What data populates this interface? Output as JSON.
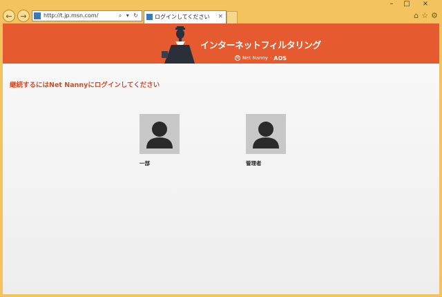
{
  "browser": {
    "address_url": "http://t.jp.msn.com/",
    "address_tools": "⌕ ▾ ↻",
    "tab_title": "ログインしてください",
    "tab_close": "×",
    "back_icon": "←",
    "forward_icon": "→",
    "window_controls": {
      "minimize": "–",
      "maximize": "□",
      "close": "×"
    },
    "right_icons": {
      "home": "⌂",
      "favorites": "☆",
      "settings": "⚙"
    }
  },
  "banner": {
    "title": "インターネットフィルタリング",
    "brand_mark": "N",
    "brand_name": "Net Nanny",
    "separator": "·",
    "partner": "AOS",
    "color": "#e55a2f"
  },
  "page": {
    "prompt": "継続するにはNet Nannyにログインしてください",
    "prompt_color": "#d44a25"
  },
  "users": [
    {
      "name": "一部",
      "icon": "user-avatar-icon"
    },
    {
      "name": "管理者",
      "icon": "user-avatar-icon"
    }
  ]
}
